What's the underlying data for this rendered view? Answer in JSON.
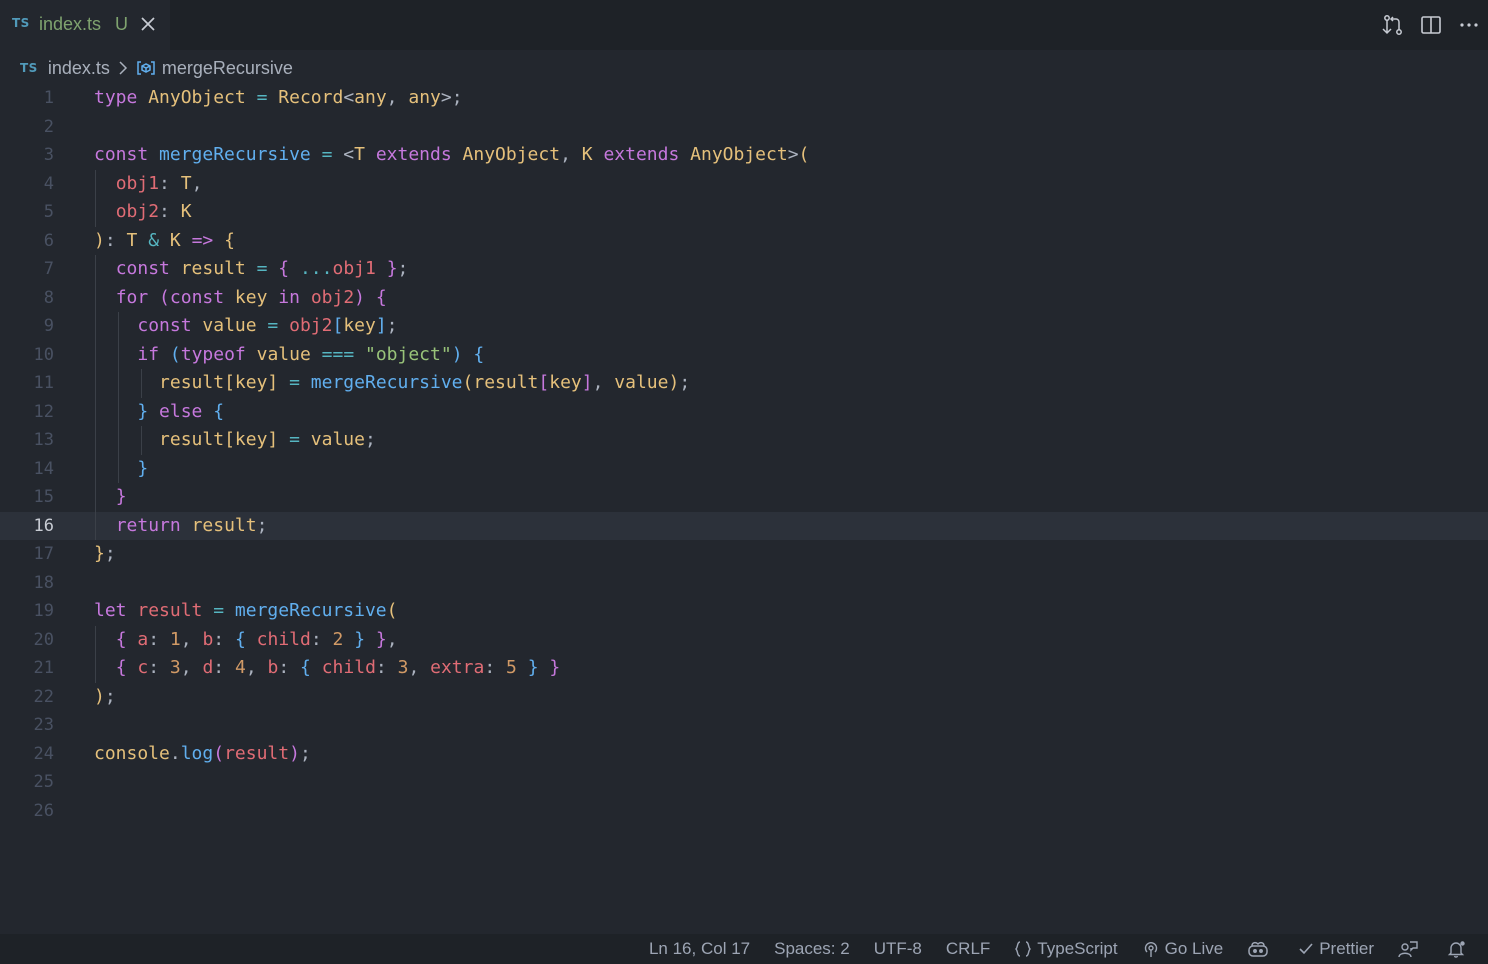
{
  "tab": {
    "lang_badge": "TS",
    "filename": "index.ts",
    "git_status": "U"
  },
  "tab_actions": {
    "icons": [
      "open-changes-icon",
      "split-editor-icon",
      "more-actions-icon"
    ]
  },
  "breadcrumb": {
    "lang_badge": "TS",
    "file": "index.ts",
    "symbol": "mergeRecursive"
  },
  "editor": {
    "current_line": 16,
    "lines": [
      {
        "n": "1",
        "tokens": [
          [
            "kw",
            "type"
          ],
          [
            "pl",
            " "
          ],
          [
            "ty",
            "AnyObject"
          ],
          [
            "pl",
            " "
          ],
          [
            "op",
            "="
          ],
          [
            "pl",
            " "
          ],
          [
            "ty",
            "Record"
          ],
          [
            "pl",
            "<"
          ],
          [
            "ty",
            "any"
          ],
          [
            "pl",
            ", "
          ],
          [
            "ty",
            "any"
          ],
          [
            "pl",
            ">;"
          ]
        ]
      },
      {
        "n": "2",
        "tokens": []
      },
      {
        "n": "3",
        "tokens": [
          [
            "kw",
            "const"
          ],
          [
            "pl",
            " "
          ],
          [
            "fn",
            "mergeRecursive"
          ],
          [
            "pl",
            " "
          ],
          [
            "op",
            "="
          ],
          [
            "pl",
            " "
          ],
          [
            "pl",
            "<"
          ],
          [
            "ty",
            "T"
          ],
          [
            "pl",
            " "
          ],
          [
            "kw",
            "extends"
          ],
          [
            "pl",
            " "
          ],
          [
            "ty",
            "AnyObject"
          ],
          [
            "pl",
            ", "
          ],
          [
            "ty",
            "K"
          ],
          [
            "pl",
            " "
          ],
          [
            "kw",
            "extends"
          ],
          [
            "pl",
            " "
          ],
          [
            "ty",
            "AnyObject"
          ],
          [
            "pl",
            ">"
          ],
          [
            "b1",
            "("
          ]
        ]
      },
      {
        "n": "4",
        "tokens": [
          [
            "pl",
            "  "
          ],
          [
            "prm",
            "obj1"
          ],
          [
            "pl",
            ": "
          ],
          [
            "ty",
            "T"
          ],
          [
            "pl",
            ","
          ]
        ]
      },
      {
        "n": "5",
        "tokens": [
          [
            "pl",
            "  "
          ],
          [
            "prm",
            "obj2"
          ],
          [
            "pl",
            ": "
          ],
          [
            "ty",
            "K"
          ]
        ]
      },
      {
        "n": "6",
        "tokens": [
          [
            "b1",
            ")"
          ],
          [
            "pl",
            ": "
          ],
          [
            "ty",
            "T"
          ],
          [
            "pl",
            " "
          ],
          [
            "op",
            "&"
          ],
          [
            "pl",
            " "
          ],
          [
            "ty",
            "K"
          ],
          [
            "pl",
            " "
          ],
          [
            "kw",
            "=>"
          ],
          [
            "pl",
            " "
          ],
          [
            "b1",
            "{"
          ]
        ]
      },
      {
        "n": "7",
        "tokens": [
          [
            "pl",
            "  "
          ],
          [
            "kw",
            "const"
          ],
          [
            "pl",
            " "
          ],
          [
            "lv",
            "result"
          ],
          [
            "pl",
            " "
          ],
          [
            "op",
            "="
          ],
          [
            "pl",
            " "
          ],
          [
            "b2",
            "{"
          ],
          [
            "pl",
            " "
          ],
          [
            "op",
            "..."
          ],
          [
            "var",
            "obj1"
          ],
          [
            "pl",
            " "
          ],
          [
            "b2",
            "}"
          ],
          [
            "pl",
            ";"
          ]
        ]
      },
      {
        "n": "8",
        "tokens": [
          [
            "pl",
            "  "
          ],
          [
            "kw",
            "for"
          ],
          [
            "pl",
            " "
          ],
          [
            "b2",
            "("
          ],
          [
            "kw",
            "const"
          ],
          [
            "pl",
            " "
          ],
          [
            "lv",
            "key"
          ],
          [
            "pl",
            " "
          ],
          [
            "kw",
            "in"
          ],
          [
            "pl",
            " "
          ],
          [
            "var",
            "obj2"
          ],
          [
            "b2",
            ")"
          ],
          [
            "pl",
            " "
          ],
          [
            "b2",
            "{"
          ]
        ]
      },
      {
        "n": "9",
        "tokens": [
          [
            "pl",
            "    "
          ],
          [
            "kw",
            "const"
          ],
          [
            "pl",
            " "
          ],
          [
            "lv",
            "value"
          ],
          [
            "pl",
            " "
          ],
          [
            "op",
            "="
          ],
          [
            "pl",
            " "
          ],
          [
            "var",
            "obj2"
          ],
          [
            "b3",
            "["
          ],
          [
            "lv",
            "key"
          ],
          [
            "b3",
            "]"
          ],
          [
            "pl",
            ";"
          ]
        ]
      },
      {
        "n": "10",
        "tokens": [
          [
            "pl",
            "    "
          ],
          [
            "kw",
            "if"
          ],
          [
            "pl",
            " "
          ],
          [
            "b3",
            "("
          ],
          [
            "kw",
            "typeof"
          ],
          [
            "pl",
            " "
          ],
          [
            "lv",
            "value"
          ],
          [
            "pl",
            " "
          ],
          [
            "op",
            "==="
          ],
          [
            "pl",
            " "
          ],
          [
            "str",
            "\"object\""
          ],
          [
            "b3",
            ")"
          ],
          [
            "pl",
            " "
          ],
          [
            "b3",
            "{"
          ]
        ]
      },
      {
        "n": "11",
        "tokens": [
          [
            "pl",
            "      "
          ],
          [
            "lv",
            "result"
          ],
          [
            "b1",
            "["
          ],
          [
            "lv",
            "key"
          ],
          [
            "b1",
            "]"
          ],
          [
            "pl",
            " "
          ],
          [
            "op",
            "="
          ],
          [
            "pl",
            " "
          ],
          [
            "fn",
            "mergeRecursive"
          ],
          [
            "b1",
            "("
          ],
          [
            "lv",
            "result"
          ],
          [
            "b2",
            "["
          ],
          [
            "lv",
            "key"
          ],
          [
            "b2",
            "]"
          ],
          [
            "pl",
            ", "
          ],
          [
            "lv",
            "value"
          ],
          [
            "b1",
            ")"
          ],
          [
            "pl",
            ";"
          ]
        ]
      },
      {
        "n": "12",
        "tokens": [
          [
            "pl",
            "    "
          ],
          [
            "b3",
            "}"
          ],
          [
            "pl",
            " "
          ],
          [
            "kw",
            "else"
          ],
          [
            "pl",
            " "
          ],
          [
            "b3",
            "{"
          ]
        ]
      },
      {
        "n": "13",
        "tokens": [
          [
            "pl",
            "      "
          ],
          [
            "lv",
            "result"
          ],
          [
            "b1",
            "["
          ],
          [
            "lv",
            "key"
          ],
          [
            "b1",
            "]"
          ],
          [
            "pl",
            " "
          ],
          [
            "op",
            "="
          ],
          [
            "pl",
            " "
          ],
          [
            "lv",
            "value"
          ],
          [
            "pl",
            ";"
          ]
        ]
      },
      {
        "n": "14",
        "tokens": [
          [
            "pl",
            "    "
          ],
          [
            "b3",
            "}"
          ]
        ]
      },
      {
        "n": "15",
        "tokens": [
          [
            "pl",
            "  "
          ],
          [
            "b2",
            "}"
          ]
        ]
      },
      {
        "n": "16",
        "tokens": [
          [
            "pl",
            "  "
          ],
          [
            "kw",
            "return"
          ],
          [
            "pl",
            " "
          ],
          [
            "lv",
            "result"
          ],
          [
            "pl",
            ";"
          ]
        ]
      },
      {
        "n": "17",
        "tokens": [
          [
            "b1",
            "}"
          ],
          [
            "pl",
            ";"
          ]
        ]
      },
      {
        "n": "18",
        "tokens": []
      },
      {
        "n": "19",
        "tokens": [
          [
            "kw",
            "let"
          ],
          [
            "pl",
            " "
          ],
          [
            "var",
            "result"
          ],
          [
            "pl",
            " "
          ],
          [
            "op",
            "="
          ],
          [
            "pl",
            " "
          ],
          [
            "fn",
            "mergeRecursive"
          ],
          [
            "b1",
            "("
          ]
        ]
      },
      {
        "n": "20",
        "tokens": [
          [
            "pl",
            "  "
          ],
          [
            "b2",
            "{"
          ],
          [
            "pl",
            " "
          ],
          [
            "prm",
            "a"
          ],
          [
            "pl",
            ": "
          ],
          [
            "num",
            "1"
          ],
          [
            "pl",
            ", "
          ],
          [
            "prm",
            "b"
          ],
          [
            "pl",
            ": "
          ],
          [
            "b3",
            "{"
          ],
          [
            "pl",
            " "
          ],
          [
            "prm",
            "child"
          ],
          [
            "pl",
            ": "
          ],
          [
            "num",
            "2"
          ],
          [
            "pl",
            " "
          ],
          [
            "b3",
            "}"
          ],
          [
            "pl",
            " "
          ],
          [
            "b2",
            "}"
          ],
          [
            "pl",
            ","
          ]
        ]
      },
      {
        "n": "21",
        "tokens": [
          [
            "pl",
            "  "
          ],
          [
            "b2",
            "{"
          ],
          [
            "pl",
            " "
          ],
          [
            "prm",
            "c"
          ],
          [
            "pl",
            ": "
          ],
          [
            "num",
            "3"
          ],
          [
            "pl",
            ", "
          ],
          [
            "prm",
            "d"
          ],
          [
            "pl",
            ": "
          ],
          [
            "num",
            "4"
          ],
          [
            "pl",
            ", "
          ],
          [
            "prm",
            "b"
          ],
          [
            "pl",
            ": "
          ],
          [
            "b3",
            "{"
          ],
          [
            "pl",
            " "
          ],
          [
            "prm",
            "child"
          ],
          [
            "pl",
            ": "
          ],
          [
            "num",
            "3"
          ],
          [
            "pl",
            ", "
          ],
          [
            "prm",
            "extra"
          ],
          [
            "pl",
            ": "
          ],
          [
            "num",
            "5"
          ],
          [
            "pl",
            " "
          ],
          [
            "b3",
            "}"
          ],
          [
            "pl",
            " "
          ],
          [
            "b2",
            "}"
          ]
        ]
      },
      {
        "n": "22",
        "tokens": [
          [
            "b1",
            ")"
          ],
          [
            "pl",
            ";"
          ]
        ]
      },
      {
        "n": "23",
        "tokens": []
      },
      {
        "n": "24",
        "tokens": [
          [
            "ty",
            "console"
          ],
          [
            "pl",
            "."
          ],
          [
            "fn",
            "log"
          ],
          [
            "b2",
            "("
          ],
          [
            "var",
            "result"
          ],
          [
            "b2",
            ")"
          ],
          [
            "pl",
            ";"
          ]
        ]
      },
      {
        "n": "25",
        "tokens": []
      },
      {
        "n": "26",
        "tokens": []
      }
    ]
  },
  "status": {
    "position": "Ln 16, Col 17",
    "indent": "Spaces: 2",
    "encoding": "UTF-8",
    "eol": "CRLF",
    "language": "TypeScript",
    "golive": "Go Live",
    "prettier": "Prettier"
  },
  "colors": {
    "editor_bg": "#23272e",
    "tab_bg": "#1e2227",
    "keyword": "#c678dd",
    "type": "#e5c07b",
    "function": "#61afef",
    "variable": "#e06c75",
    "number": "#d19a66",
    "string": "#98c379",
    "git_untracked": "#7fa36f"
  }
}
